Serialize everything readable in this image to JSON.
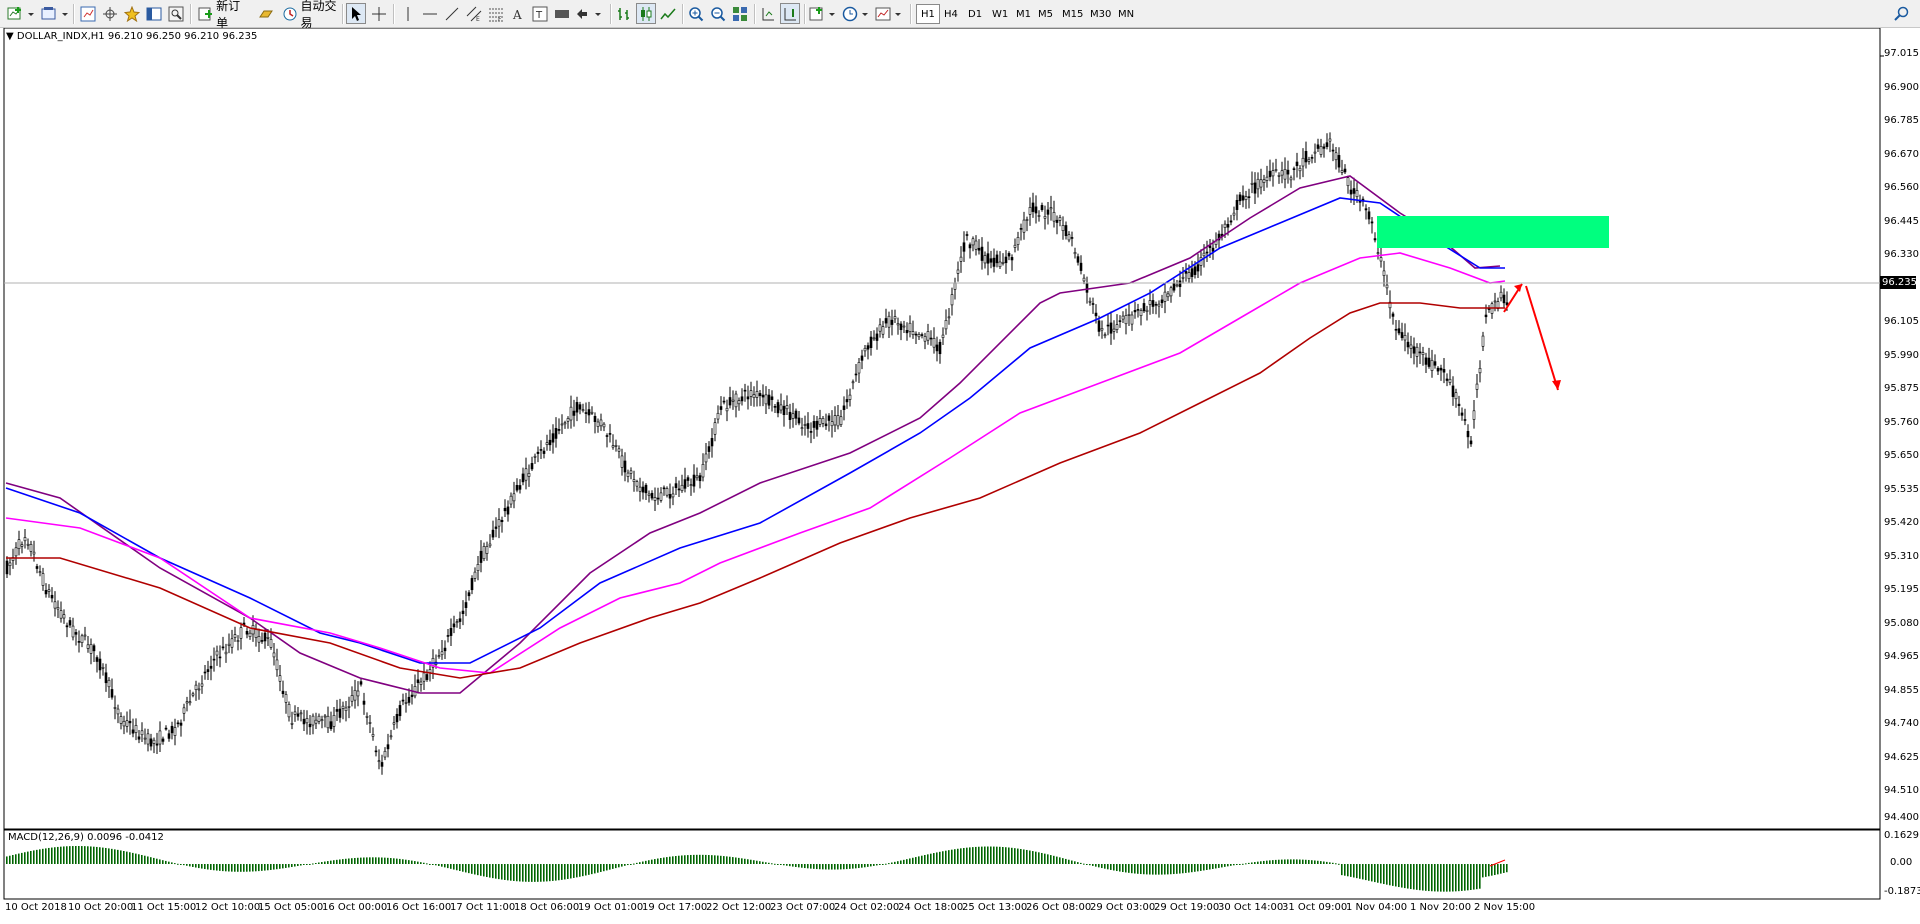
{
  "toolbar": {
    "new_order": "新订单",
    "auto_trading": "自动交易",
    "tools": [
      "new-chart-icon",
      "profiles-icon",
      "market-watch-icon",
      "navigator-icon",
      "crosshair-cursor-icon",
      "terminal-icon",
      "strategy-tester-icon",
      "gold-bar-icon",
      "cursor-icon",
      "crosshair-icon",
      "vertical-line-icon",
      "horizontal-line-icon",
      "trendline-icon",
      "equidistant-channel-icon",
      "fibonacci-icon",
      "text-icon",
      "text-label-icon",
      "arrow-shapes-icon",
      "bar-chart-icon",
      "candlestick-icon",
      "line-chart-icon",
      "zoom-in-icon",
      "zoom-out-icon",
      "tile-windows-icon",
      "autoscroll-icon",
      "chart-shift-icon",
      "indicators-icon",
      "period-clock-icon",
      "templates-icon",
      "search-icon"
    ],
    "periods": [
      "H1",
      "H4",
      "D1",
      "W1",
      "M1",
      "M5",
      "M15",
      "M30",
      "MN"
    ],
    "active_period": "H1"
  },
  "chart": {
    "symbol_header": "DOLLAR_INDX,H1  96.210 96.250 96.210 96.235",
    "current_price": "96.235",
    "colors": {
      "candles": "#000000",
      "ma_purple": "#800080",
      "ma_blue": "#0000ff",
      "ma_magenta": "#ff00ff",
      "ma_darkred": "#b00000",
      "zone": "#00ff7f",
      "arrows": "#ff0000",
      "macd": "#006400"
    },
    "price_axis": [
      "97.015",
      "96.900",
      "96.785",
      "96.670",
      "96.560",
      "96.445",
      "96.330",
      "96.105",
      "95.990",
      "95.875",
      "95.760",
      "95.650",
      "95.535",
      "95.420",
      "95.310",
      "95.195",
      "95.080",
      "94.965",
      "94.855",
      "94.740",
      "94.625",
      "94.510",
      "94.400"
    ],
    "time_axis": [
      "10 Oct 2018",
      "10 Oct 20:00",
      "11 Oct 15:00",
      "12 Oct 10:00",
      "15 Oct 05:00",
      "16 Oct 00:00",
      "16 Oct 16:00",
      "17 Oct 11:00",
      "18 Oct 06:00",
      "19 Oct 01:00",
      "19 Oct 17:00",
      "22 Oct 12:00",
      "23 Oct 07:00",
      "24 Oct 02:00",
      "24 Oct 18:00",
      "25 Oct 13:00",
      "26 Oct 08:00",
      "29 Oct 03:00",
      "29 Oct 19:00",
      "30 Oct 14:00",
      "31 Oct 09:00",
      "1 Nov 04:00",
      "1 Nov 20:00",
      "2 Nov 15:00"
    ]
  },
  "macd": {
    "label": "MACD(12,26,9) 0.0096 -0.0412",
    "axis": [
      "0.1629",
      "0.00",
      "-0.1873"
    ]
  }
}
